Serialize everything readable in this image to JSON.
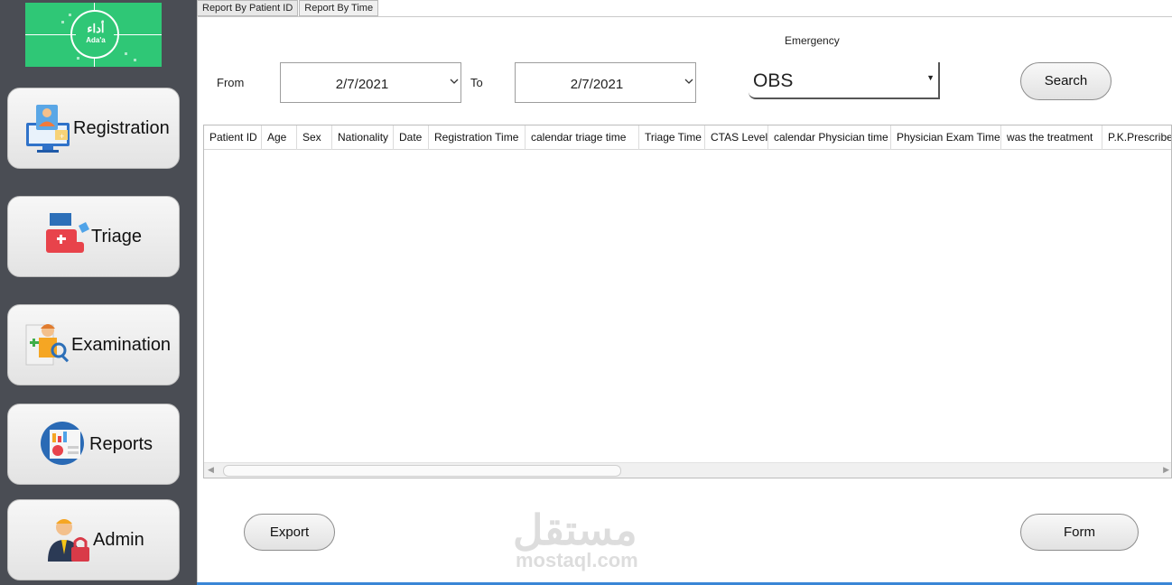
{
  "sidebar": {
    "logo": {
      "arabic": "أداء",
      "latin": "Ada'a"
    },
    "items": [
      {
        "label": "Registration",
        "icon": "registration-monitor-icon"
      },
      {
        "label": "Triage",
        "icon": "first-aid-kit-icon"
      },
      {
        "label": "Examination",
        "icon": "doctor-report-icon"
      },
      {
        "label": "Reports",
        "icon": "reports-chart-icon"
      },
      {
        "label": "Admin",
        "icon": "admin-lock-icon"
      }
    ]
  },
  "tabs": [
    "Report By Patient ID",
    "Report By Time"
  ],
  "filters": {
    "from_label": "From",
    "to_label": "To",
    "from_date": "2/7/2021",
    "to_date": "2/7/2021",
    "emergency_label": "Emergency",
    "emergency_value": "OBS",
    "search_label": "Search"
  },
  "table": {
    "columns": [
      "Patient ID",
      "Age",
      "Sex",
      "Nationality",
      "Date",
      "Registration Time",
      "calendar triage time",
      "Triage Time",
      "CTAS Level",
      "calendar Physician time",
      "Physician Exam Time",
      "was the treatment",
      "P.K.Prescribed"
    ]
  },
  "actions": {
    "export_label": "Export",
    "form_label": "Form"
  },
  "watermark": {
    "arabic": "مستقل",
    "latin": "mostaql.com"
  },
  "colors": {
    "sidebar_bg": "#4a4d54",
    "logo_bg": "#2fc776",
    "accent_line": "#3a86d6"
  }
}
